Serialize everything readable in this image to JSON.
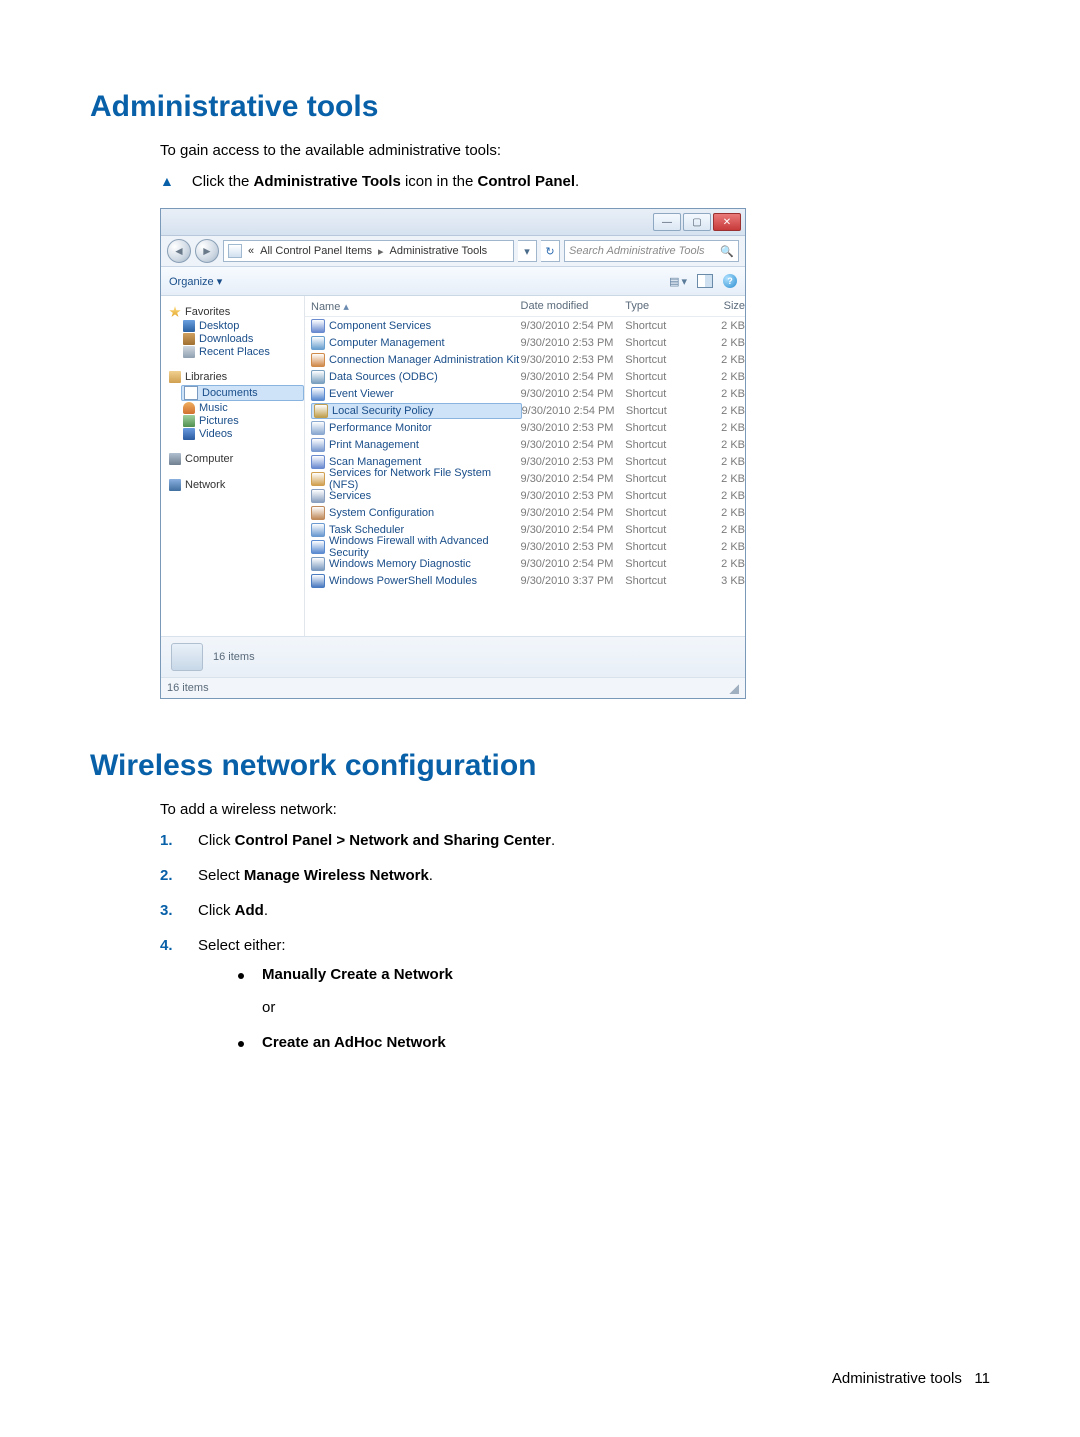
{
  "headings": {
    "admin_tools": "Administrative tools",
    "wireless_config": "Wireless network configuration"
  },
  "admin_tools": {
    "intro": "To gain access to the available administrative tools:",
    "bullet_prefix": "Click the ",
    "bullet_b1": "Administrative Tools",
    "bullet_mid": " icon in the ",
    "bullet_b2": "Control Panel",
    "bullet_suffix": "."
  },
  "wireless": {
    "intro": "To add a wireless network:",
    "step1_pre": "Click ",
    "step1_b": "Control Panel > Network and Sharing Center",
    "step1_post": ".",
    "step2_pre": "Select ",
    "step2_b": "Manage Wireless Network",
    "step2_post": ".",
    "step3_pre": "Click ",
    "step3_b": "Add",
    "step3_post": ".",
    "step4": "Select either:",
    "opt1": "Manually Create a Network",
    "or": "or",
    "opt2": "Create an AdHoc Network"
  },
  "footer": {
    "label": "Administrative tools",
    "page": "11"
  },
  "explorer": {
    "breadcrumb": {
      "dbl_arrow": "«",
      "p1": "All Control Panel Items",
      "sep": "▸",
      "p2": "Administrative Tools"
    },
    "search_placeholder": "Search Administrative Tools",
    "organize": "Organize ▾",
    "columns": {
      "name": "Name",
      "date": "Date modified",
      "type": "Type",
      "size": "Size"
    },
    "nav": {
      "favorites": "Favorites",
      "desktop": "Desktop",
      "downloads": "Downloads",
      "recent": "Recent Places",
      "libraries": "Libraries",
      "documents": "Documents",
      "music": "Music",
      "pictures": "Pictures",
      "videos": "Videos",
      "computer": "Computer",
      "network": "Network"
    },
    "items": [
      {
        "name": "Component Services",
        "date": "9/30/2010 2:54 PM",
        "type": "Shortcut",
        "size": "2 KB",
        "color": "#6a8ad0"
      },
      {
        "name": "Computer Management",
        "date": "9/30/2010 2:53 PM",
        "type": "Shortcut",
        "size": "2 KB",
        "color": "#6aa0d0"
      },
      {
        "name": "Connection Manager Administration Kit",
        "date": "9/30/2010 2:53 PM",
        "type": "Shortcut",
        "size": "2 KB",
        "color": "#d08a4a"
      },
      {
        "name": "Data Sources (ODBC)",
        "date": "9/30/2010 2:54 PM",
        "type": "Shortcut",
        "size": "2 KB",
        "color": "#7aa0c0"
      },
      {
        "name": "Event Viewer",
        "date": "9/30/2010 2:54 PM",
        "type": "Shortcut",
        "size": "2 KB",
        "color": "#5a8ad0"
      },
      {
        "name": "Local Security Policy",
        "date": "9/30/2010 2:54 PM",
        "type": "Shortcut",
        "size": "2 KB",
        "color": "#c0a050",
        "selected": true
      },
      {
        "name": "Performance Monitor",
        "date": "9/30/2010 2:53 PM",
        "type": "Shortcut",
        "size": "2 KB",
        "color": "#8aa8d0"
      },
      {
        "name": "Print Management",
        "date": "9/30/2010 2:54 PM",
        "type": "Shortcut",
        "size": "2 KB",
        "color": "#7a9ad0"
      },
      {
        "name": "Scan Management",
        "date": "9/30/2010 2:53 PM",
        "type": "Shortcut",
        "size": "2 KB",
        "color": "#6a8ad0"
      },
      {
        "name": "Services for Network File System (NFS)",
        "date": "9/30/2010 2:54 PM",
        "type": "Shortcut",
        "size": "2 KB",
        "color": "#d0a050"
      },
      {
        "name": "Services",
        "date": "9/30/2010 2:53 PM",
        "type": "Shortcut",
        "size": "2 KB",
        "color": "#8aa0c0"
      },
      {
        "name": "System Configuration",
        "date": "9/30/2010 2:54 PM",
        "type": "Shortcut",
        "size": "2 KB",
        "color": "#c08a5a"
      },
      {
        "name": "Task Scheduler",
        "date": "9/30/2010 2:54 PM",
        "type": "Shortcut",
        "size": "2 KB",
        "color": "#6a9ad0"
      },
      {
        "name": "Windows Firewall with Advanced Security",
        "date": "9/30/2010 2:53 PM",
        "type": "Shortcut",
        "size": "2 KB",
        "color": "#5a8ad0"
      },
      {
        "name": "Windows Memory Diagnostic",
        "date": "9/30/2010 2:54 PM",
        "type": "Shortcut",
        "size": "2 KB",
        "color": "#7a9ac0"
      },
      {
        "name": "Windows PowerShell Modules",
        "date": "9/30/2010 3:37 PM",
        "type": "Shortcut",
        "size": "3 KB",
        "color": "#4a7ac0"
      }
    ],
    "details": "16 items",
    "status": "16 items"
  }
}
